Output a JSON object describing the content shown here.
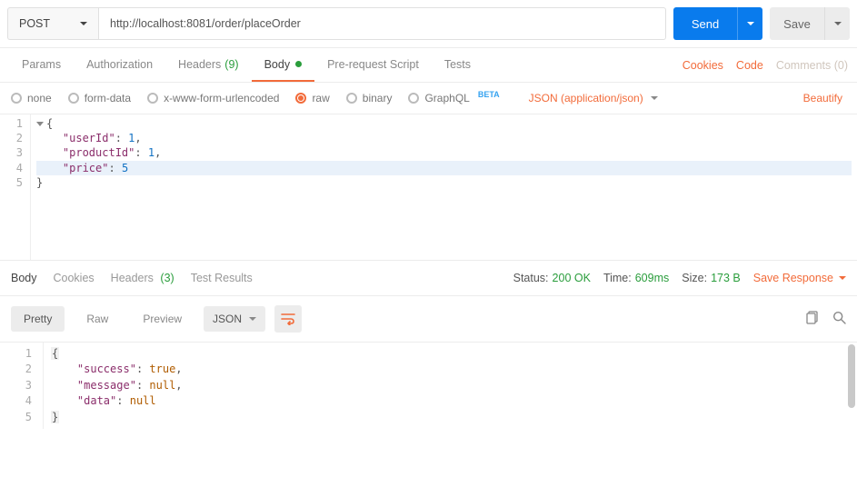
{
  "request": {
    "method": "POST",
    "url": "http://localhost:8081/order/placeOrder",
    "send": "Send",
    "save": "Save"
  },
  "tabs": {
    "params": "Params",
    "auth": "Authorization",
    "headers": "Headers",
    "headers_count": "(9)",
    "body": "Body",
    "prerequest": "Pre-request Script",
    "tests": "Tests"
  },
  "links": {
    "cookies": "Cookies",
    "code": "Code",
    "comments": "Comments (0)"
  },
  "bodyModes": {
    "none": "none",
    "formdata": "form-data",
    "urlencoded": "x-www-form-urlencoded",
    "raw": "raw",
    "binary": "binary",
    "graphql": "GraphQL",
    "beta": "BETA",
    "content_type": "JSON (application/json)",
    "beautify": "Beautify"
  },
  "editor": {
    "lines": [
      "1",
      "2",
      "3",
      "4",
      "5"
    ],
    "l1": "{",
    "k_userId": "\"userId\"",
    "v_userId": "1",
    "k_productId": "\"productId\"",
    "v_productId": "1",
    "k_price": "\"price\"",
    "v_price": "5",
    "l5": "}"
  },
  "response": {
    "tabs": {
      "body": "Body",
      "cookies": "Cookies",
      "headers": "Headers",
      "headers_count": "(3)",
      "test_results": "Test Results"
    },
    "status_label": "Status:",
    "status_value": "200 OK",
    "time_label": "Time:",
    "time_value": "609ms",
    "size_label": "Size:",
    "size_value": "173 B",
    "save_response": "Save Response",
    "viewer": {
      "pretty": "Pretty",
      "raw": "Raw",
      "preview": "Preview",
      "format": "JSON"
    },
    "code": {
      "lines": [
        "1",
        "2",
        "3",
        "4",
        "5"
      ],
      "l1": "{",
      "k_success": "\"success\"",
      "v_success": "true",
      "k_message": "\"message\"",
      "v_message": "null",
      "k_data": "\"data\"",
      "v_data": "null",
      "l5": "}"
    }
  }
}
